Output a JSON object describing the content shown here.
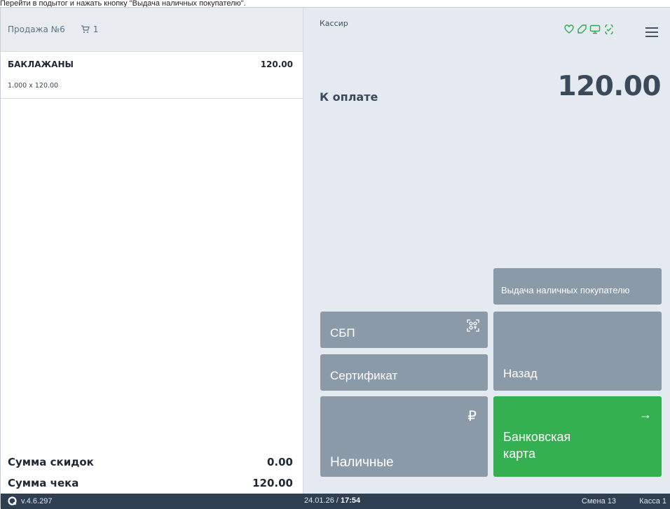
{
  "caption": "Перейти в подытог и нажать кнопку \"Выдача наличных покупателю\".",
  "sale": {
    "title": "Продажа №6",
    "cart_count": "1"
  },
  "items": [
    {
      "name": "БАКЛАЖАНЫ",
      "sum": "120.00",
      "qty_price": "1.000 x 120.00"
    }
  ],
  "totals": {
    "discount_label": "Сумма скидок",
    "discount_value": "0.00",
    "check_label": "Сумма чека",
    "check_value": "120.00"
  },
  "header": {
    "cashier": "Кассир"
  },
  "payment": {
    "label": "К оплате",
    "amount": "120.00"
  },
  "buttons": {
    "cash_out": "Выдача наличных покупателю",
    "sbp": "СБП",
    "certificate": "Сертификат",
    "back": "Назад",
    "cash": "Наличные",
    "cash_symbol": "₽",
    "card_line1": "Банковская",
    "card_line2": "карта",
    "card_arrow": "→"
  },
  "footer": {
    "version": "v.4.6.297",
    "date": "24.01.26 / ",
    "time": "17:54",
    "shift": "Смена 13",
    "register": "Касса 1"
  },
  "colors": {
    "accent_green": "#34b051",
    "button_gray": "#8a9aa8",
    "footer_bg": "#2e3f51",
    "icon_green": "#2fa84f"
  },
  "icons": [
    "cart-icon",
    "heart-icon",
    "tag-icon",
    "monitor-icon",
    "check-circle-icon",
    "menu-icon",
    "qr-icon",
    "ruble-icon",
    "arrow-right-icon",
    "logo-icon"
  ]
}
